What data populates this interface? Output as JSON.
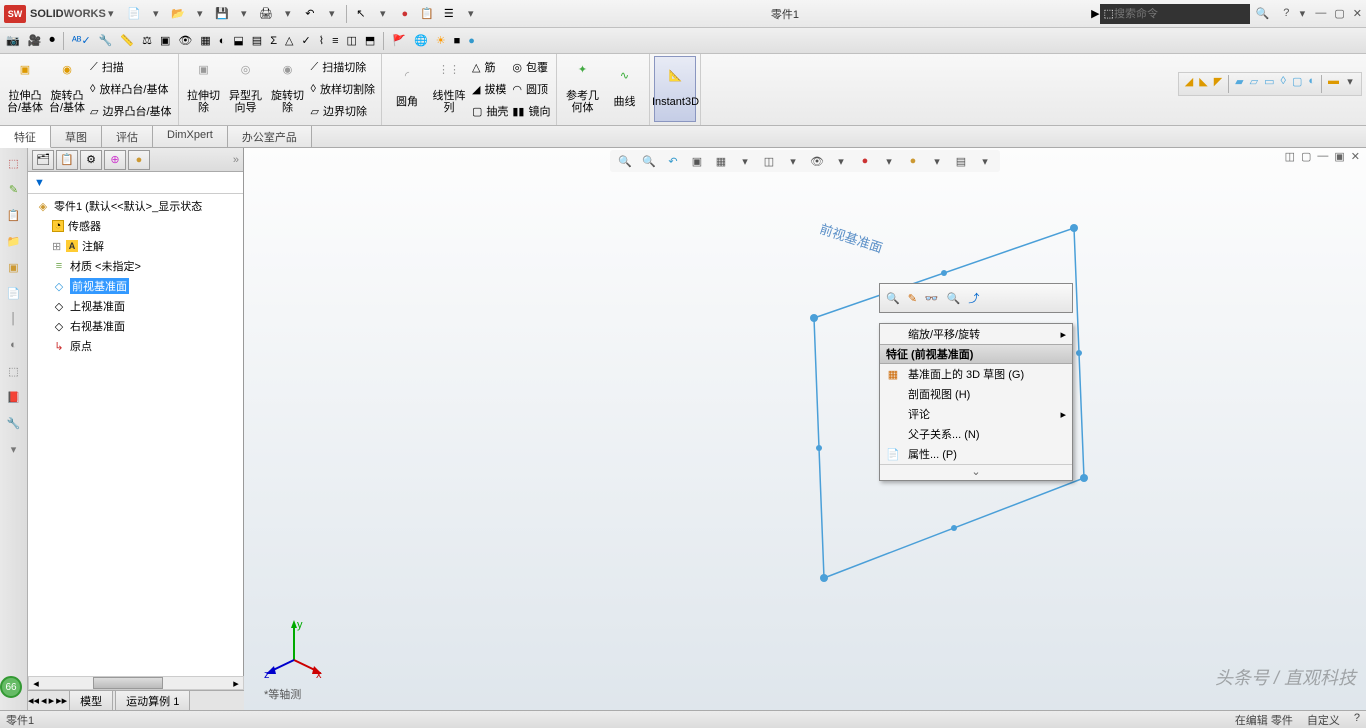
{
  "app": {
    "brand_solid": "SOLID",
    "brand_works": "WORKS",
    "doc_title": "零件1"
  },
  "search": {
    "placeholder": "搜索命令"
  },
  "tabs": [
    "特征",
    "草图",
    "评估",
    "DimXpert",
    "办公室产品"
  ],
  "ribbon": {
    "extrude": "拉伸凸台/基体",
    "revolve": "旋转凸台/基体",
    "sweep": "扫描",
    "loft": "放样凸台/基体",
    "bound": "边界凸台/基体",
    "extcut": "拉伸切除",
    "hole": "异型孔向导",
    "revcut": "旋转切除",
    "sweepcut": "扫描切除",
    "loftcut": "放样切割除",
    "boundcut": "边界切除",
    "fillet": "圆角",
    "pattern": "线性阵列",
    "rib": "筋",
    "draft": "拔模",
    "shell": "抽壳",
    "wrap": "包覆",
    "dome": "圆顶",
    "mirror": "镜向",
    "refgeom": "参考几何体",
    "curves": "曲线",
    "instant3d": "Instant3D"
  },
  "tree": {
    "root": "零件1 (默认<<默认>_显示状态",
    "sensors": "传感器",
    "annotations": "注解",
    "material": "材质 <未指定>",
    "front": "前视基准面",
    "top": "上视基准面",
    "right": "右视基准面",
    "origin": "原点"
  },
  "context": {
    "zoom": "缩放/平移/旋转",
    "feature_header": "特征 (前视基准面)",
    "sketch3d": "基准面上的 3D 草图 (G)",
    "section": "剖面视图 (H)",
    "comment": "评论",
    "parent": "父子关系... (N)",
    "props": "属性... (P)"
  },
  "viewport": {
    "plane_label": "前视基准面",
    "orientation": "*等轴测",
    "triad": {
      "x": "x",
      "y": "y",
      "z": "z"
    }
  },
  "bottom_tabs": [
    "模型",
    "运动算例 1"
  ],
  "status": {
    "left": "零件1",
    "edit": "在编辑 零件",
    "custom": "自定义",
    "badge": "66"
  },
  "watermark": "头条号 / 直观科技"
}
